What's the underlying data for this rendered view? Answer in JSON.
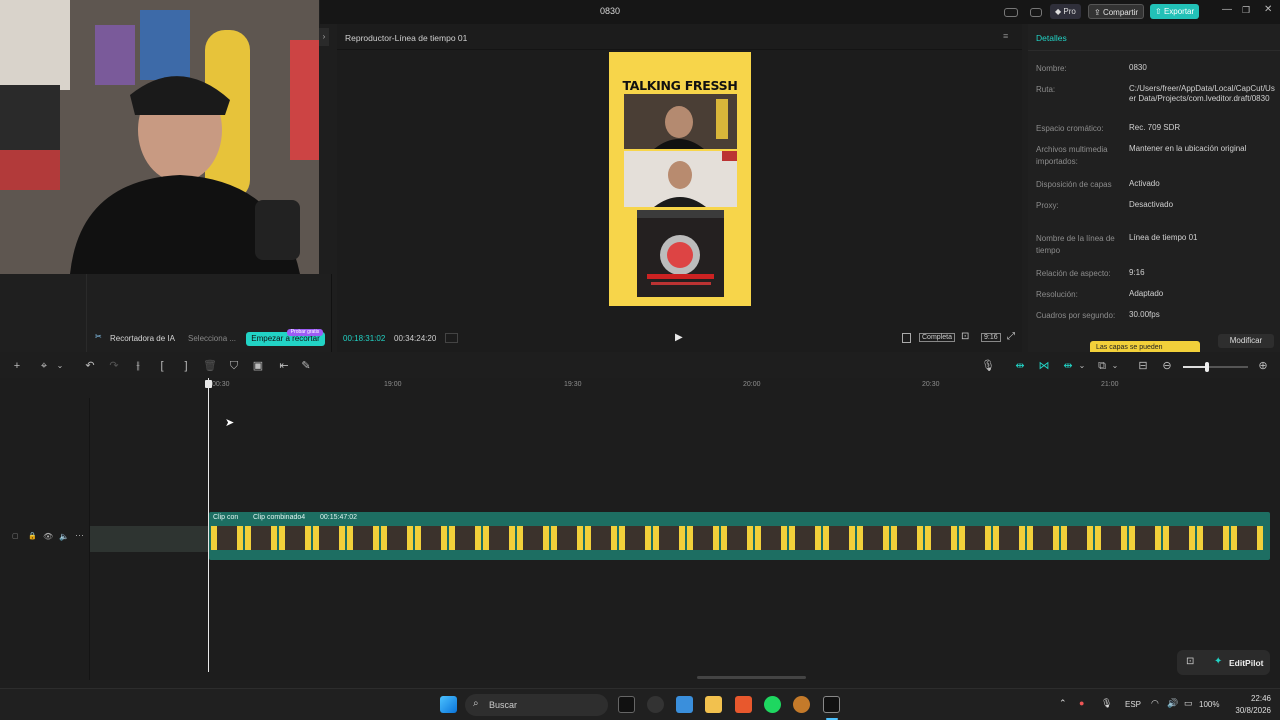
{
  "window": {
    "title": "0830",
    "pro_label": "Pro",
    "share_label": "Compartir",
    "export_label": "Exportar"
  },
  "left_panel": {
    "ai_cutter_label": "Recortadora de IA",
    "select_label": "Selecciona ...",
    "start_button": "Empezar a recortar",
    "free_badge": "Probar gratis"
  },
  "player": {
    "title": "Reproductor-Línea de tiempo 01",
    "current_time": "00:18:31:02",
    "total_time": "00:34:24:20",
    "complete_label": "Completa",
    "ratio_label": "9:16",
    "preview_title": "TALKING FRESSH"
  },
  "details": {
    "header": "Detalles",
    "rows": [
      {
        "label": "Nombre:",
        "value": "0830"
      },
      {
        "label": "Ruta:",
        "value": "C:/Users/freer/AppData/Local/CapCut/User Data/Projects/com.lveditor.draft/0830"
      },
      {
        "label": "Espacio cromático:",
        "value": "Rec. 709 SDR"
      },
      {
        "label": "Archivos multimedia importados:",
        "value": "Mantener en la ubicación original"
      },
      {
        "label": "Disposición de capas",
        "value": "Activado"
      },
      {
        "label": "Proxy:",
        "value": "Desactivado"
      },
      {
        "label": "Nombre de la línea de tiempo",
        "value": "Línea de tiempo 01"
      },
      {
        "label": "Relación de aspecto:",
        "value": "9:16"
      },
      {
        "label": "Resolución:",
        "value": "Adaptado"
      },
      {
        "label": "Cuadros por segundo:",
        "value": "30.00fps"
      }
    ],
    "tooltip": "Las capas se pueden",
    "modify_button": "Modificar"
  },
  "timeline": {
    "ticks": [
      "00:30",
      "19:00",
      "19:30",
      "20:00",
      "20:30",
      "21:00"
    ],
    "clip1_label": "Clip con",
    "clip2_label": "Clip combinado4",
    "clip2_duration": "00:15:47:02"
  },
  "editpilot": {
    "label": "EditPilot"
  },
  "taskbar": {
    "search_placeholder": "Buscar",
    "language": "ESP",
    "battery": "100%",
    "time": "22:46",
    "date": "30/8/2026"
  },
  "colors": {
    "accent": "#22d3c5",
    "clip": "#1d6e62",
    "preview_bg": "#f7d54a"
  }
}
